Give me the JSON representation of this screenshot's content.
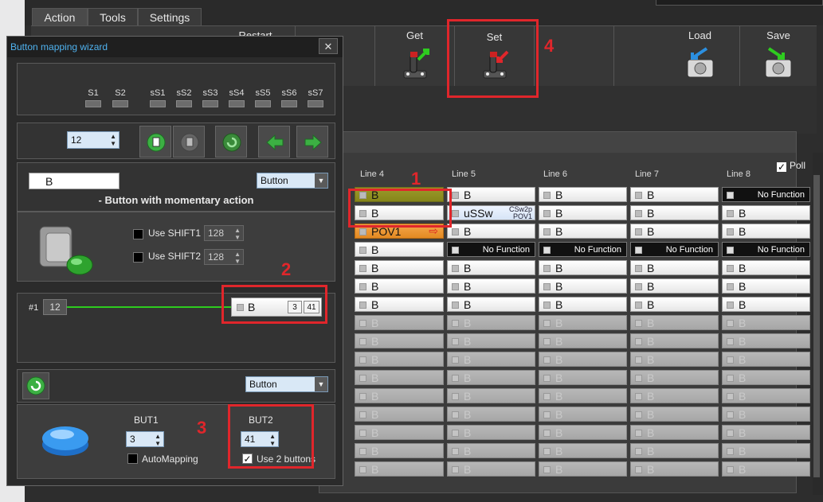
{
  "menu": {
    "tabs": [
      "Action",
      "Tools",
      "Settings"
    ]
  },
  "ribbon": {
    "partial_label": "Restart",
    "get_label": "Get",
    "set_label": "Set",
    "load_label": "Load",
    "save_label": "Save"
  },
  "grid": {
    "poll_label": "Poll",
    "poll_checked": true,
    "columns": [
      "Line 4",
      "Line 5",
      "Line 6",
      "Line 7",
      "Line 8"
    ],
    "rows": [
      [
        {
          "t": "B",
          "s": "olive"
        },
        {
          "t": "B",
          "s": "normal"
        },
        {
          "t": "B",
          "s": "normal"
        },
        {
          "t": "B",
          "s": "normal"
        },
        {
          "t": "No Function",
          "s": "nf"
        }
      ],
      [
        {
          "t": "B",
          "s": "normal"
        },
        {
          "t": "uSSw",
          "s": "uss",
          "cs": "CSw2p\nPOV1"
        },
        {
          "t": "B",
          "s": "normal"
        },
        {
          "t": "B",
          "s": "normal"
        },
        {
          "t": "B",
          "s": "normal"
        }
      ],
      [
        {
          "t": "POV1",
          "s": "orange"
        },
        {
          "t": "B",
          "s": "normal"
        },
        {
          "t": "B",
          "s": "normal"
        },
        {
          "t": "B",
          "s": "normal"
        },
        {
          "t": "B",
          "s": "normal"
        }
      ],
      [
        {
          "t": "B",
          "s": "normal"
        },
        {
          "t": "No Function",
          "s": "nf"
        },
        {
          "t": "No Function",
          "s": "nf"
        },
        {
          "t": "No Function",
          "s": "nf"
        },
        {
          "t": "No Function",
          "s": "nf"
        }
      ],
      [
        {
          "t": "B",
          "s": "normal"
        },
        {
          "t": "B",
          "s": "normal"
        },
        {
          "t": "B",
          "s": "normal"
        },
        {
          "t": "B",
          "s": "normal"
        },
        {
          "t": "B",
          "s": "normal"
        }
      ],
      [
        {
          "t": "B",
          "s": "normal"
        },
        {
          "t": "B",
          "s": "normal"
        },
        {
          "t": "B",
          "s": "normal"
        },
        {
          "t": "B",
          "s": "normal"
        },
        {
          "t": "B",
          "s": "normal"
        }
      ],
      [
        {
          "t": "B",
          "s": "normal"
        },
        {
          "t": "B",
          "s": "normal"
        },
        {
          "t": "B",
          "s": "normal"
        },
        {
          "t": "B",
          "s": "normal"
        },
        {
          "t": "B",
          "s": "normal"
        }
      ],
      [
        {
          "t": "B",
          "s": "dis"
        },
        {
          "t": "B",
          "s": "dis"
        },
        {
          "t": "B",
          "s": "dis"
        },
        {
          "t": "B",
          "s": "dis"
        },
        {
          "t": "B",
          "s": "dis"
        }
      ],
      [
        {
          "t": "B",
          "s": "dis"
        },
        {
          "t": "B",
          "s": "dis"
        },
        {
          "t": "B",
          "s": "dis"
        },
        {
          "t": "B",
          "s": "dis"
        },
        {
          "t": "B",
          "s": "dis"
        }
      ],
      [
        {
          "t": "B",
          "s": "dis"
        },
        {
          "t": "B",
          "s": "dis"
        },
        {
          "t": "B",
          "s": "dis"
        },
        {
          "t": "B",
          "s": "dis"
        },
        {
          "t": "B",
          "s": "dis"
        }
      ],
      [
        {
          "t": "B",
          "s": "dis"
        },
        {
          "t": "B",
          "s": "dis"
        },
        {
          "t": "B",
          "s": "dis"
        },
        {
          "t": "B",
          "s": "dis"
        },
        {
          "t": "B",
          "s": "dis"
        }
      ],
      [
        {
          "t": "B",
          "s": "dis"
        },
        {
          "t": "B",
          "s": "dis"
        },
        {
          "t": "B",
          "s": "dis"
        },
        {
          "t": "B",
          "s": "dis"
        },
        {
          "t": "B",
          "s": "dis"
        }
      ],
      [
        {
          "t": "B",
          "s": "dis"
        },
        {
          "t": "B",
          "s": "dis"
        },
        {
          "t": "B",
          "s": "dis"
        },
        {
          "t": "B",
          "s": "dis"
        },
        {
          "t": "B",
          "s": "dis"
        }
      ],
      [
        {
          "t": "B",
          "s": "dis"
        },
        {
          "t": "B",
          "s": "dis"
        },
        {
          "t": "B",
          "s": "dis"
        },
        {
          "t": "B",
          "s": "dis"
        },
        {
          "t": "B",
          "s": "dis"
        }
      ],
      [
        {
          "t": "B",
          "s": "dis"
        },
        {
          "t": "B",
          "s": "dis"
        },
        {
          "t": "B",
          "s": "dis"
        },
        {
          "t": "B",
          "s": "dis"
        },
        {
          "t": "B",
          "s": "dis"
        }
      ],
      [
        {
          "t": "B",
          "s": "dis"
        },
        {
          "t": "B",
          "s": "dis"
        },
        {
          "t": "B",
          "s": "dis"
        },
        {
          "t": "B",
          "s": "dis"
        },
        {
          "t": "B",
          "s": "dis"
        }
      ]
    ]
  },
  "annotations": [
    "1",
    "2",
    "3",
    "4"
  ],
  "wizard": {
    "title": "Button mapping wizard",
    "close": "✕",
    "shift_slots": [
      "S1",
      "S2",
      "sS1",
      "sS2",
      "sS3",
      "sS4",
      "sS5",
      "sS6",
      "sS7"
    ],
    "button_number": "12",
    "function_value": "B",
    "type_combo": "Button",
    "description": "- Button with momentary action",
    "use_shift1_label": "Use SHIFT1",
    "use_shift1_value": "128",
    "use_shift2_label": "Use SHIFT2",
    "use_shift2_value": "128",
    "map_index": "#1",
    "map_source": "12",
    "map_target_label": "B",
    "map_target_a": "3",
    "map_target_b": "41",
    "output_combo": "Button",
    "but1_label": "BUT1",
    "but1_value": "3",
    "automapping_label": "AutoMapping",
    "but2_label": "BUT2",
    "but2_value": "41",
    "use2buttons_label": "Use 2 buttons",
    "use2buttons_checked": true
  },
  "colors": {
    "accent_red": "#e0262b",
    "title_blue": "#4fb2ef",
    "green_line": "#2ecc1f"
  }
}
